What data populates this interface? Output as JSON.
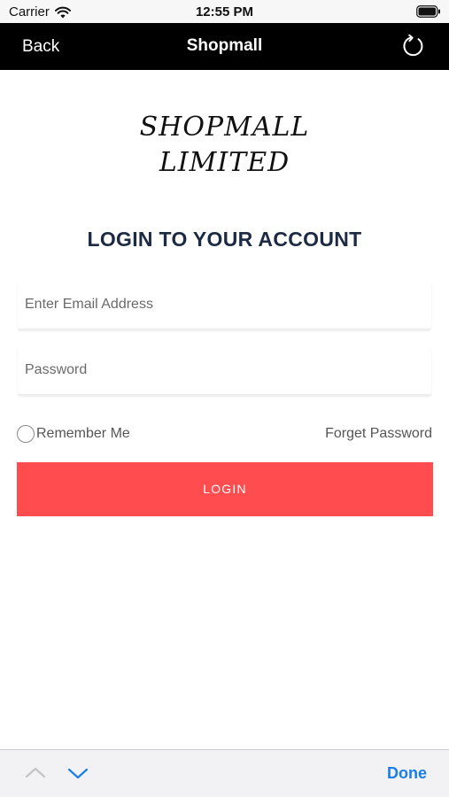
{
  "status_bar": {
    "carrier": "Carrier",
    "time": "12:55 PM",
    "wifi_icon": "wifi-icon",
    "battery_icon": "battery-icon"
  },
  "nav": {
    "back_label": "Back",
    "title": "Shopmall",
    "refresh_icon": "refresh-icon"
  },
  "logo": {
    "line1": "SHOPMALL",
    "line2": "LIMITED"
  },
  "heading": "LOGIN TO YOUR ACCOUNT",
  "form": {
    "email_placeholder": "Enter Email Address",
    "email_value": "",
    "password_placeholder": "Password",
    "password_value": "",
    "remember_label": "Remember Me",
    "remember_checked": false,
    "forgot_label": "Forget Password",
    "login_label": "LOGIN"
  },
  "accessory": {
    "up_icon": "chevron-up-icon",
    "down_icon": "chevron-down-icon",
    "done_label": "Done"
  },
  "colors": {
    "nav_background": "#000000",
    "login_button": "#ff4d4f",
    "heading_text": "#1c2a44",
    "done_text": "#1a7ee8"
  }
}
